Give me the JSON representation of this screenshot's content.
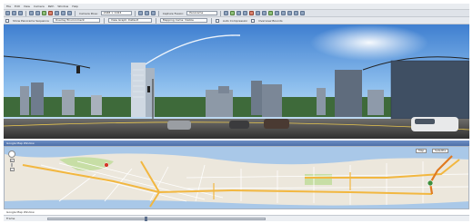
{
  "menu": {
    "items": [
      "File",
      "Edit",
      "View",
      "Camera",
      "Path",
      "Window",
      "Help"
    ]
  },
  "toolbar1": {
    "combo_label_1": "Camera Pose:",
    "combo_value_1": "2048 × 1024",
    "combo_label_2": "Capture Fusion:",
    "combo_value_2": "Panorama"
  },
  "toolbar2": {
    "field_1": "Show Panorama Sequence",
    "field_2": "Overlay Environment",
    "field_3": "View Graph: Default",
    "field_4": "Mapping Cams: Visible",
    "field_5": "Auto Compression",
    "field_6": "Overview Bounds"
  },
  "map": {
    "title": "Google Map Window",
    "btn_map": "Map",
    "btn_satellite": "Satellite",
    "zoom_plus": "+",
    "zoom_minus": "−"
  },
  "status": {
    "title": "Google Map Window",
    "left_label": "Frame",
    "slider_position": 0.45,
    "right_text": ""
  },
  "colors": {
    "route": "#f2b740",
    "water": "#a9c8e8",
    "park": "#c7dea5",
    "sky": "#7fb3e6"
  }
}
